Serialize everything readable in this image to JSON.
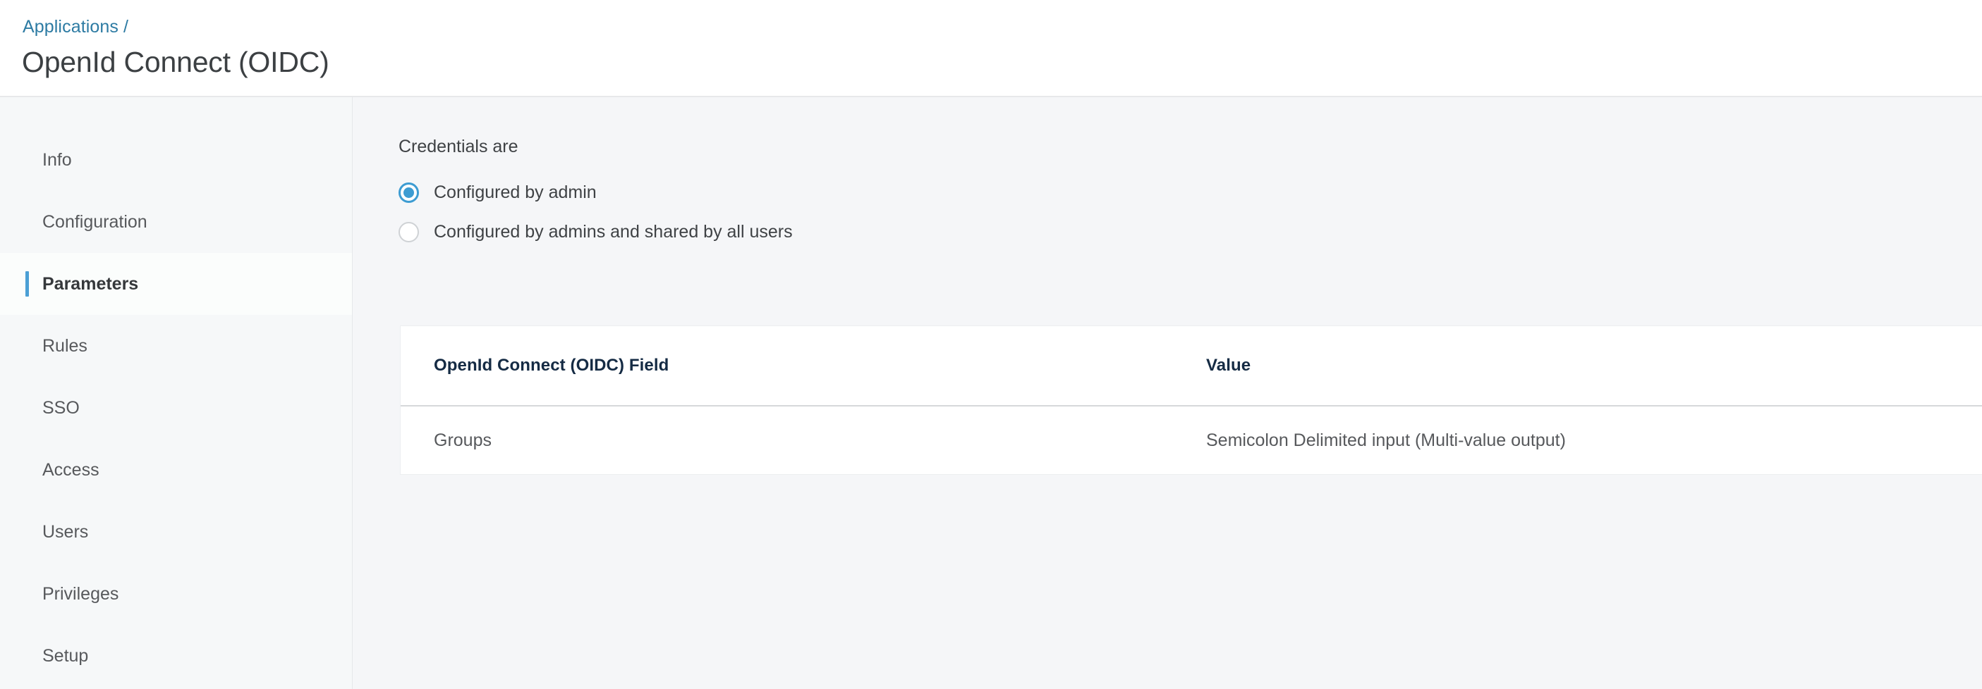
{
  "header": {
    "breadcrumb": "Applications /",
    "title": "OpenId Connect (OIDC)",
    "breadcrumb_color": "#2d7ba3",
    "title_color": "#3c4043"
  },
  "sidebar": {
    "active_index": 2,
    "accent_color": "#4b9fd5",
    "items": [
      {
        "label": "Info"
      },
      {
        "label": "Configuration"
      },
      {
        "label": "Parameters"
      },
      {
        "label": "Rules"
      },
      {
        "label": "SSO"
      },
      {
        "label": "Access"
      },
      {
        "label": "Users"
      },
      {
        "label": "Privileges"
      },
      {
        "label": "Setup"
      }
    ]
  },
  "main": {
    "credentials": {
      "label": "Credentials are",
      "selected_index": 0,
      "radio_color": "#3d9cd2",
      "options": [
        {
          "label": "Configured by admin"
        },
        {
          "label": "Configured by admins and shared by all users"
        }
      ]
    },
    "table": {
      "columns": [
        "OpenId Connect (OIDC) Field",
        "Value"
      ],
      "rows": [
        {
          "field": "Groups",
          "value": "Semicolon Delimited input (Multi-value output)"
        }
      ]
    }
  }
}
